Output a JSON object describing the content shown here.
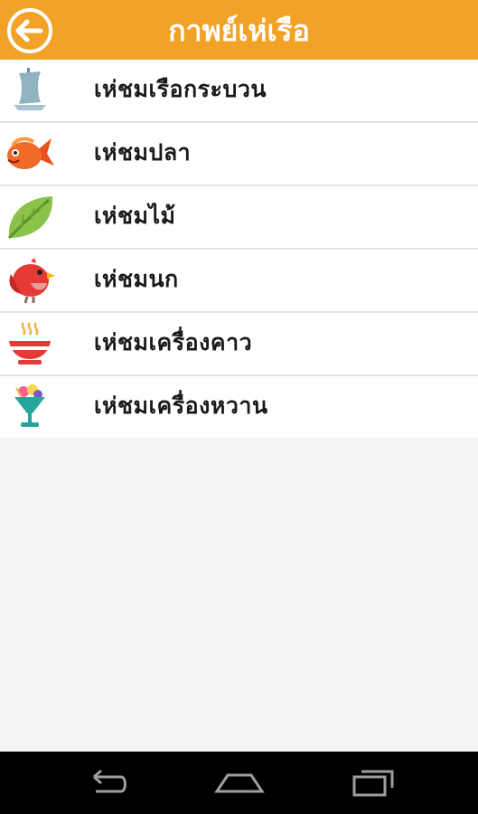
{
  "appbar": {
    "title": "กาพย์เห่เรือ",
    "accent_color": "#f2a226",
    "back_icon": "back-arrow-icon"
  },
  "menu": {
    "items": [
      {
        "label": "เห่ชมเรือกระบวน",
        "icon": "boat-icon"
      },
      {
        "label": "เห่ชมปลา",
        "icon": "fish-icon"
      },
      {
        "label": "เห่ชมไม้",
        "icon": "leaf-icon"
      },
      {
        "label": "เห่ชมนก",
        "icon": "bird-icon"
      },
      {
        "label": "เห่ชมเครื่องคาว",
        "icon": "soup-bowl-icon"
      },
      {
        "label": "เห่ชมเครื่องหวาน",
        "icon": "dessert-cup-icon"
      }
    ]
  },
  "navbar": {
    "buttons": [
      "back-nav-icon",
      "home-nav-icon",
      "recent-apps-icon"
    ]
  }
}
